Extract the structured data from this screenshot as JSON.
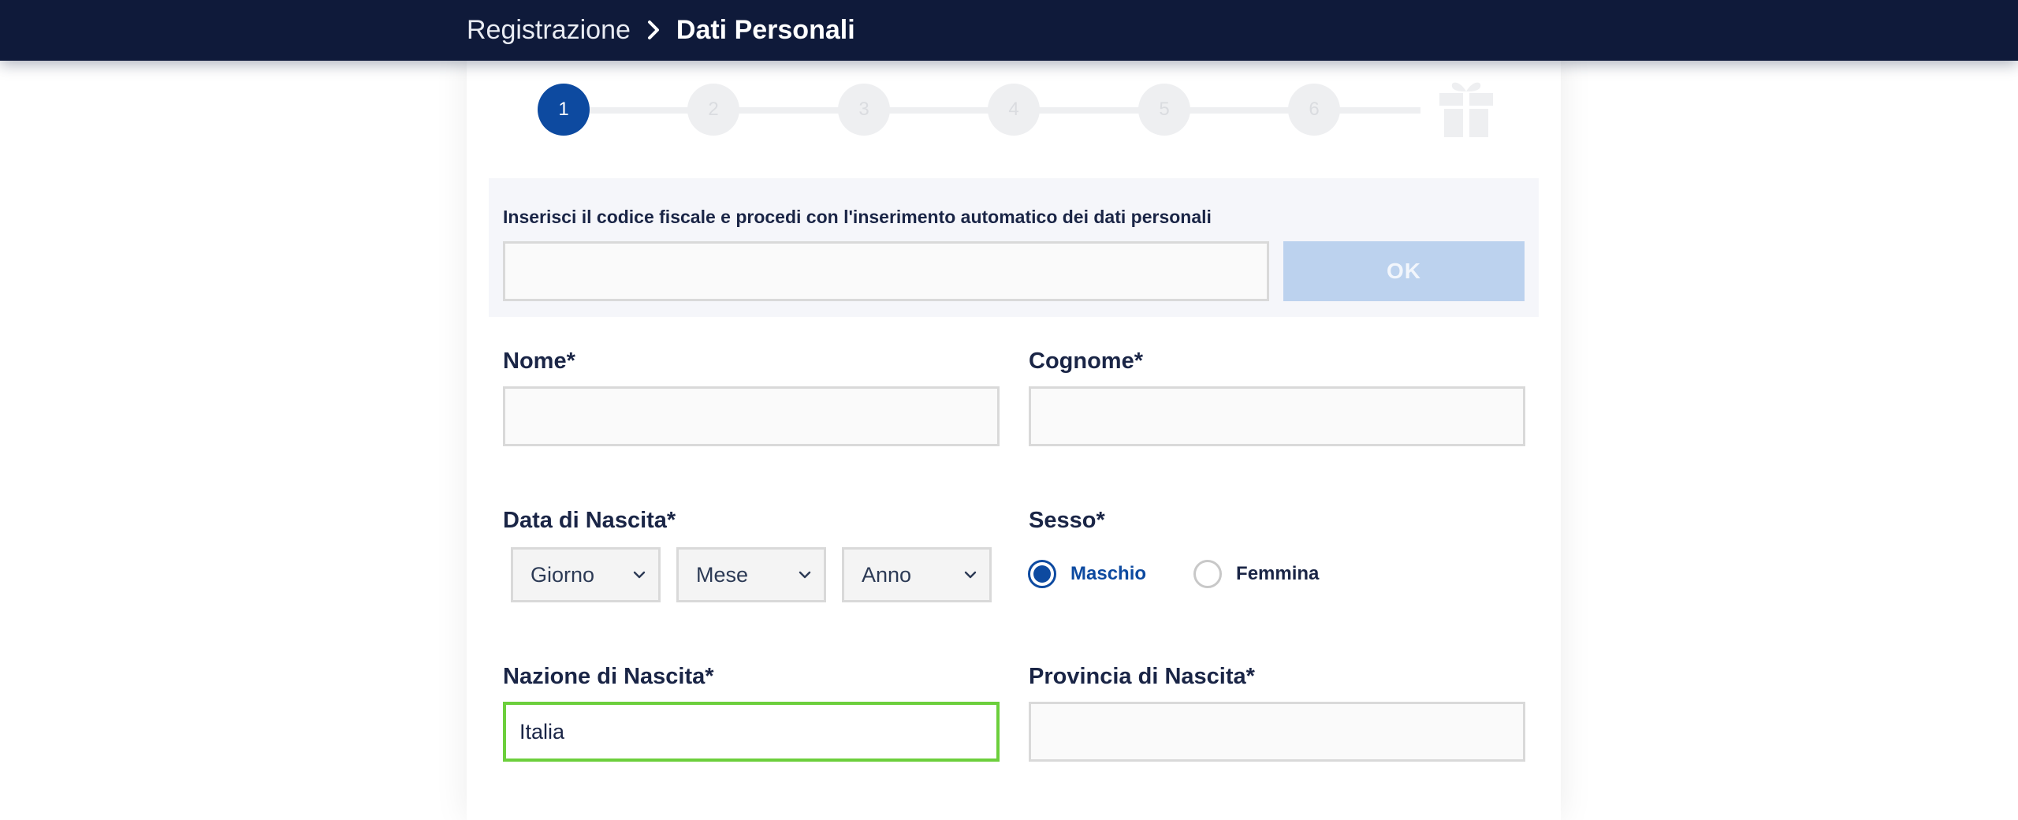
{
  "header": {
    "breadcrumb_root": "Registrazione",
    "breadcrumb_current": "Dati Personali",
    "separator_icon": "chevron-right-icon",
    "background": "#0f1a3a"
  },
  "stepper": {
    "steps": [
      "1",
      "2",
      "3",
      "4",
      "5",
      "6"
    ],
    "active_step": "1",
    "final_icon": "gift-icon",
    "active_color": "#0d4aa0"
  },
  "fiscal_code": {
    "label": "Inserisci il codice fiscale e procedi con l'inserimento automatico dei dati personali",
    "value": "",
    "button_label": "OK"
  },
  "form": {
    "nome": {
      "label": "Nome*",
      "value": ""
    },
    "cognome": {
      "label": "Cognome*",
      "value": ""
    },
    "data_nascita": {
      "label": "Data di Nascita*",
      "giorno": "Giorno",
      "mese": "Mese",
      "anno": "Anno"
    },
    "sesso": {
      "label": "Sesso*",
      "options": [
        "Maschio",
        "Femmina"
      ],
      "selected": "Maschio"
    },
    "nazione_nascita": {
      "label": "Nazione di Nascita*",
      "value": "Italia",
      "valid_color": "#6ccf3c"
    },
    "provincia_nascita": {
      "label": "Provincia di Nascita*",
      "value": ""
    }
  }
}
